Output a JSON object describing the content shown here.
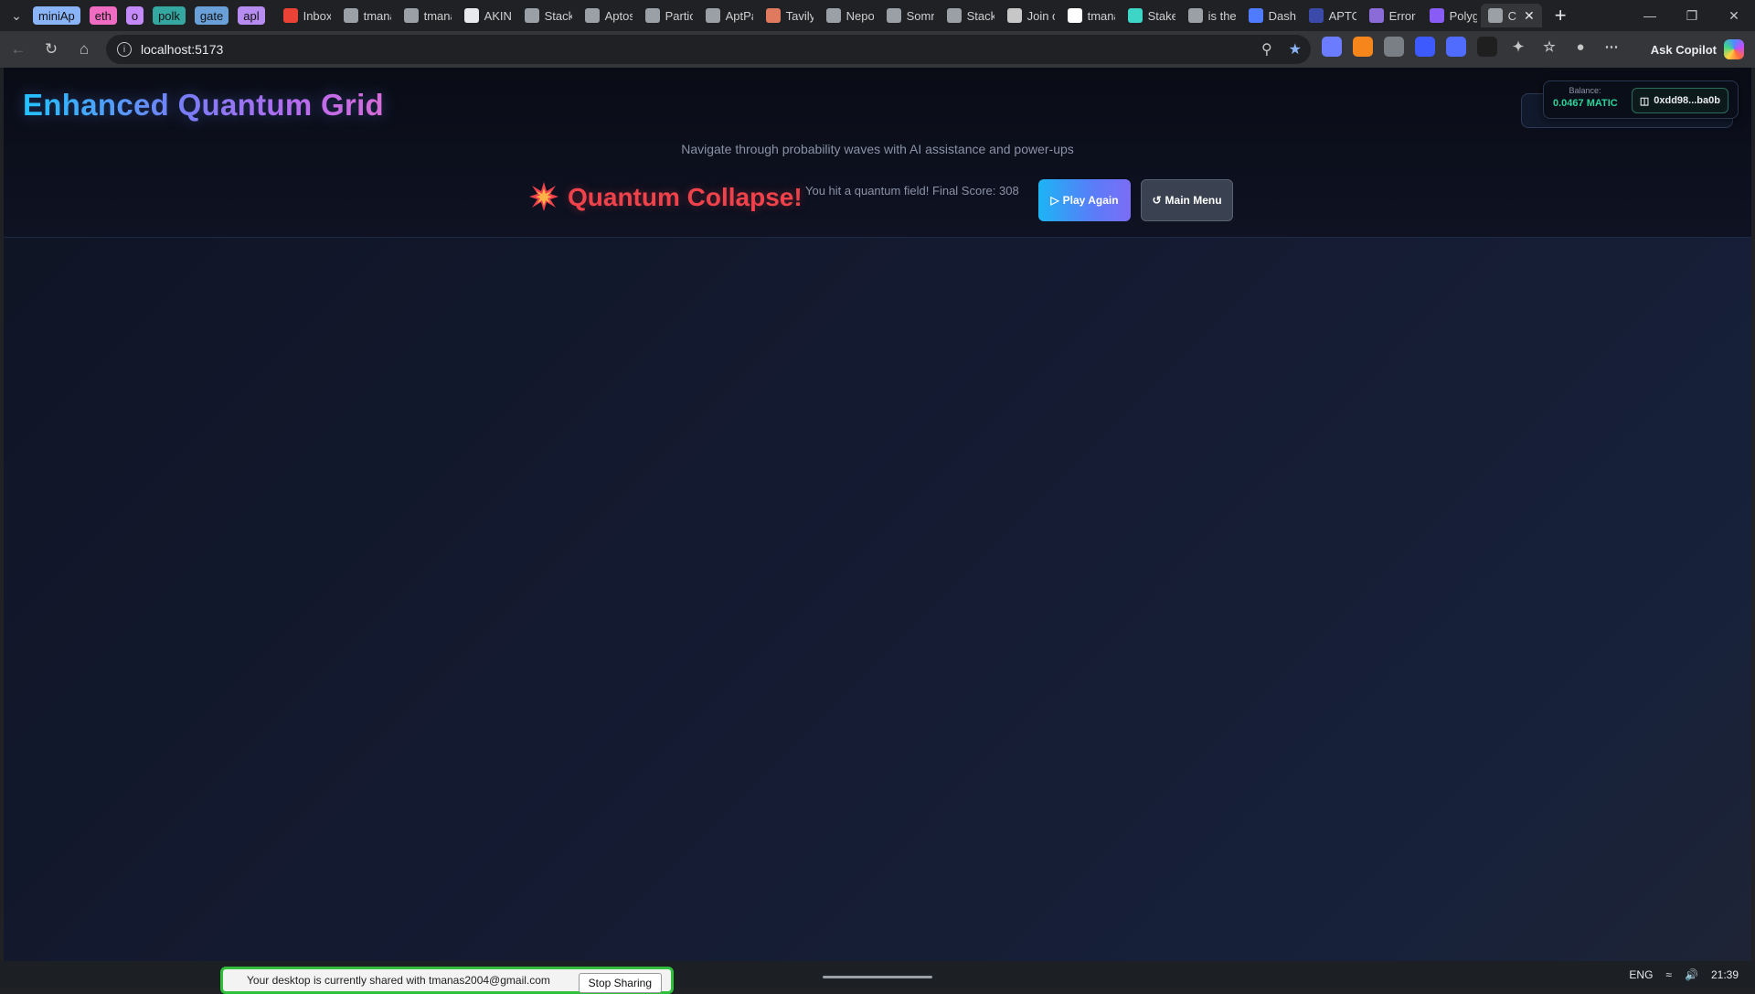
{
  "browser": {
    "tab_groups": [
      {
        "label": "miniAp",
        "color": "#8ab4f8"
      },
      {
        "label": "eth",
        "color": "#f06cc2"
      },
      {
        "label": "o",
        "color": "#c58af9"
      },
      {
        "label": "polk",
        "color": "#34a7a0"
      },
      {
        "label": "gate",
        "color": "#6aa0d8"
      },
      {
        "label": "apl",
        "color": "#b68cf0"
      }
    ],
    "tabs": [
      {
        "label": "Inbox",
        "icon": "gmail-icon",
        "color": "#ea4335"
      },
      {
        "label": "tmana",
        "icon": "page-icon",
        "color": "#9aa0a6"
      },
      {
        "label": "tmana",
        "icon": "page-icon",
        "color": "#9aa0a6"
      },
      {
        "label": "AKINE",
        "icon": "page-icon",
        "color": "#e8eaed"
      },
      {
        "label": "Stack",
        "icon": "dots-icon",
        "color": "#9aa0a6"
      },
      {
        "label": "Aptos",
        "icon": "dots-icon",
        "color": "#9aa0a6"
      },
      {
        "label": "Partic",
        "icon": "doc-icon",
        "color": "#9aa0a6"
      },
      {
        "label": "AptPa",
        "icon": "globe-icon",
        "color": "#9aa0a6"
      },
      {
        "label": "Tavily",
        "icon": "tavily-icon",
        "color": "#e07a5f"
      },
      {
        "label": "Nepo",
        "icon": "dots-icon",
        "color": "#9aa0a6"
      },
      {
        "label": "Somn",
        "icon": "dots-icon",
        "color": "#9aa0a6"
      },
      {
        "label": "Stack",
        "icon": "dots-icon",
        "color": "#9aa0a6"
      },
      {
        "label": "Join o",
        "icon": "globe-icon",
        "color": "#c7c7c7"
      },
      {
        "label": "tmana",
        "icon": "github-icon",
        "color": "#ffffff"
      },
      {
        "label": "Stake",
        "icon": "stake-icon",
        "color": "#3dd6c6"
      },
      {
        "label": "is the",
        "icon": "globe-icon",
        "color": "#9aa0a6"
      },
      {
        "label": "Dash",
        "icon": "aptos-icon",
        "color": "#4f7cff"
      },
      {
        "label": "APTO",
        "icon": "page-icon",
        "color": "#3b4aa8"
      },
      {
        "label": "Error",
        "icon": "link-icon",
        "color": "#8a6bd8"
      },
      {
        "label": "Polyg",
        "icon": "polygon-icon",
        "color": "#8a5cf6"
      }
    ],
    "active_tab": {
      "label": "C",
      "icon": "page-icon"
    },
    "new_tab_label": "+",
    "url": "localhost:5173",
    "copilot_label": "Ask Copilot",
    "extensions": [
      {
        "name": "extension-1-icon",
        "color": "#6b7cff"
      },
      {
        "name": "metamask-icon",
        "color": "#f6851b"
      },
      {
        "name": "extension-3-icon",
        "color": "#7a7f86"
      },
      {
        "name": "extension-4-icon",
        "color": "#3d5afe"
      },
      {
        "name": "extension-5-icon",
        "color": "#4f6cff"
      },
      {
        "name": "extension-6-icon",
        "color": "#1f1f1f"
      }
    ]
  },
  "game": {
    "title": "Enhanced Quantum Grid",
    "subtitle": "Navigate through probability waves with AI assistance and power-ups",
    "status_title": "Quantum Collapse!",
    "status_message": "You hit a quantum field! Final Score: 308",
    "play_again_label": "Play Again",
    "main_menu_label": "Main Menu",
    "accent_red": "#f0424b",
    "accent_cyan": "#1cb4f5"
  },
  "wallet": {
    "balance_label": "Balance:",
    "balance_value": "0.0467 MATIC",
    "address": "0xdd98...ba0b"
  },
  "system": {
    "share_message": "Your desktop is currently shared with tmanas2004@gmail.com",
    "stop_sharing_label": "Stop Sharing",
    "language": "ENG",
    "time": "21:39"
  }
}
